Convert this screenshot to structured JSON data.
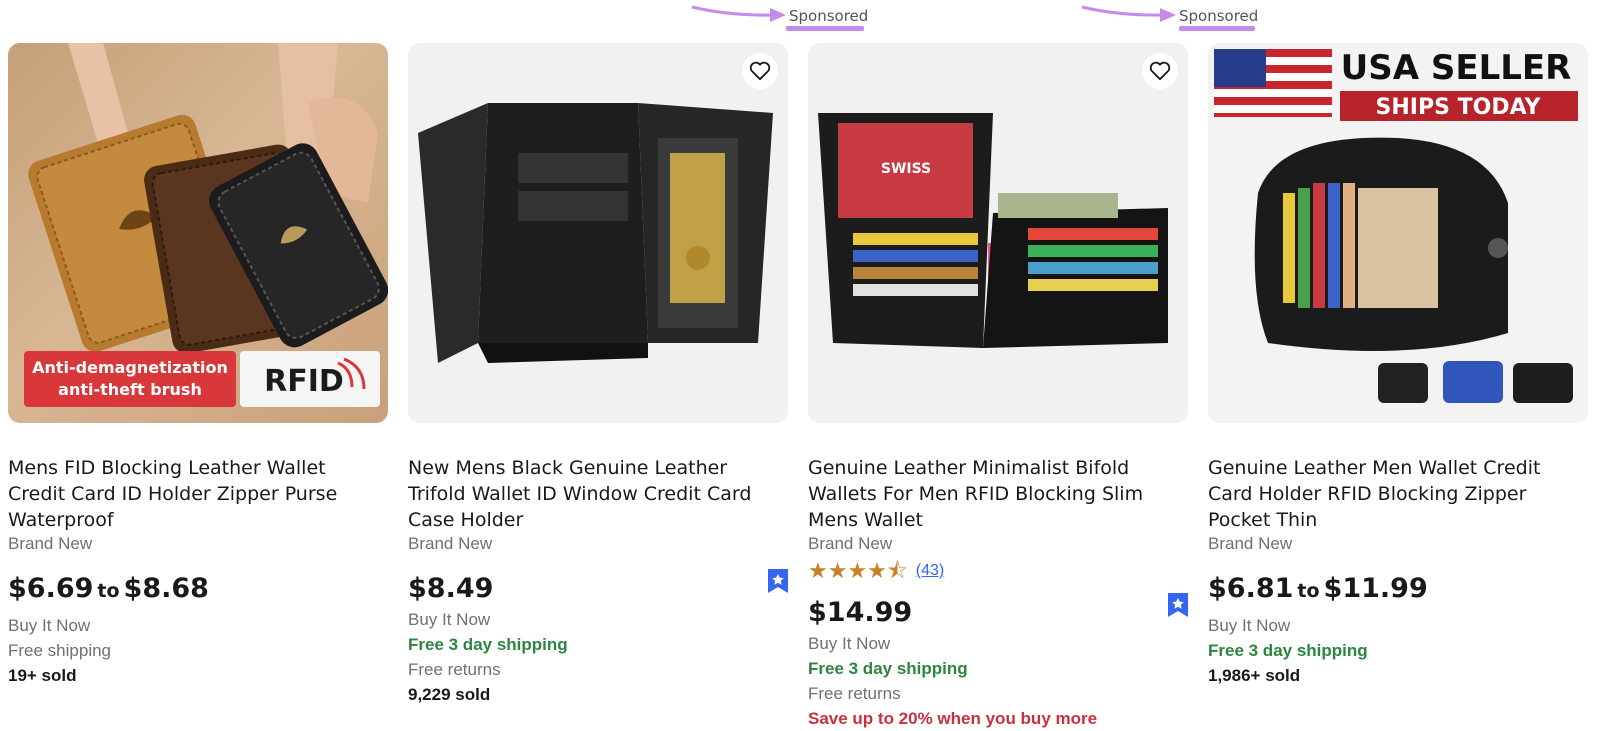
{
  "annotations": [
    {
      "label": "Sponsored"
    },
    {
      "label": "Sponsored"
    }
  ],
  "colors": {
    "annotation": "#c58bea",
    "free_shipping_green": "#2e8540",
    "promo_red": "#c7313e",
    "link_blue": "#3665f3",
    "star_gold": "#c9822a"
  },
  "listings": [
    {
      "title": "Mens FID Blocking Leather Wallet Credit Card ID Holder Zipper Purse Waterproof",
      "condition": "Brand New",
      "price_low": "$6.69",
      "price_sep": "to",
      "price_high": "$8.68",
      "format": "Buy It Now",
      "shipping": "Free shipping",
      "sold": "19+ sold",
      "image": {
        "banner_line1": "Anti-demagnetization",
        "banner_line2": "anti-theft brush",
        "logo": "RFID"
      }
    },
    {
      "title": "New Mens Black Genuine Leather Trifold Wallet ID Window Credit Card Case Holder",
      "condition": "Brand New",
      "price": "$8.49",
      "format": "Buy It Now",
      "shipping": "Free 3 day shipping",
      "returns": "Free returns",
      "sold": "9,229 sold",
      "icons": [
        "heart-icon",
        "top-rated-seller-icon"
      ]
    },
    {
      "title": "Genuine Leather Minimalist Bifold Wallets For Men RFID Blocking Slim Mens Wallet",
      "condition": "Brand New",
      "rating": 4.5,
      "rating_stars": "★★★★⯪",
      "rating_count": "(43)",
      "price": "$14.99",
      "format": "Buy It Now",
      "shipping": "Free 3 day shipping",
      "returns": "Free returns",
      "promo": "Save up to 20% when you buy more",
      "image": {
        "card_brand": "SWISS"
      },
      "icons": [
        "heart-icon",
        "top-rated-seller-icon"
      ]
    },
    {
      "title": "Genuine Leather Men Wallet Credit Card Holder RFID Blocking Zipper Pocket Thin",
      "condition": "Brand New",
      "price_low": "$6.81",
      "price_sep": "to",
      "price_high": "$11.99",
      "format": "Buy It Now",
      "shipping": "Free 3 day shipping",
      "sold": "1,986+ sold",
      "image": {
        "banner_line1": "USA SELLER",
        "banner_line2": "SHIPS TODAY"
      }
    }
  ]
}
